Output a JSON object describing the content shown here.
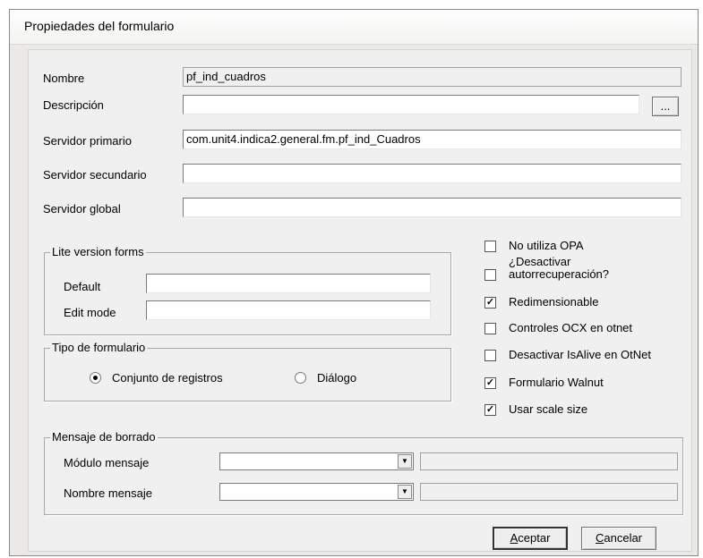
{
  "window": {
    "title": "Propiedades del formulario"
  },
  "fields": {
    "nombre": {
      "label": "Nombre",
      "value": "pf_ind_cuadros"
    },
    "descripcion": {
      "label": "Descripción",
      "value": "",
      "browse_label": "..."
    },
    "servidor_primario": {
      "label": "Servidor primario",
      "value": "com.unit4.indica2.general.fm.pf_ind_Cuadros"
    },
    "servidor_secundario": {
      "label": "Servidor secundario",
      "value": ""
    },
    "servidor_global": {
      "label": "Servidor global",
      "value": ""
    }
  },
  "lite": {
    "title": "Lite version forms",
    "default_label": "Default",
    "default_value": "",
    "edit_label": "Edit mode",
    "edit_value": ""
  },
  "tipo": {
    "title": "Tipo de formulario",
    "option1": "Conjunto de registros",
    "option1_selected": true,
    "option2": "Diálogo",
    "option2_selected": false
  },
  "options": [
    {
      "label": "No utiliza OPA",
      "checked": false
    },
    {
      "label_line1": "¿Desactivar",
      "label_line2": "autorrecuperación?",
      "checked": false
    },
    {
      "label": "Redimensionable",
      "checked": true
    },
    {
      "label": "Controles OCX en otnet",
      "checked": false
    },
    {
      "label": "Desactivar IsAlive en OtNet",
      "checked": false
    },
    {
      "label": "Formulario Walnut",
      "checked": true
    },
    {
      "label": "Usar scale size",
      "checked": true
    }
  ],
  "mensaje": {
    "title": "Mensaje de borrado",
    "modulo_label": "Módulo mensaje",
    "nombre_label": "Nombre mensaje"
  },
  "buttons": {
    "aceptar_first": "A",
    "aceptar_rest": "ceptar",
    "cancelar_first": "C",
    "cancelar_rest": "ancelar"
  }
}
